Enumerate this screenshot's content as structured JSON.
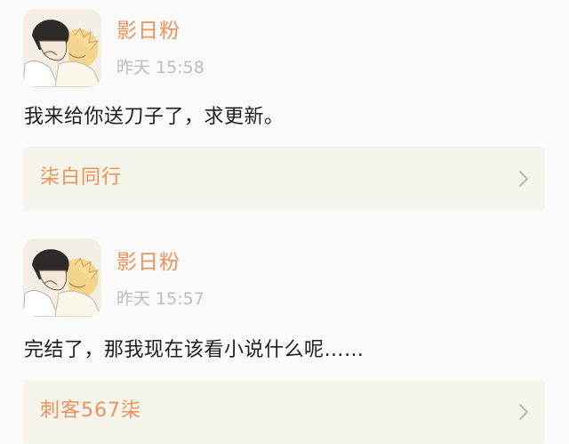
{
  "comments": [
    {
      "username": "影日粉",
      "timestamp": "昨天 15:58",
      "content": "我来给你送刀子了，求更新。",
      "reference": {
        "title": "柒白同行"
      }
    },
    {
      "username": "影日粉",
      "timestamp": "昨天 15:57",
      "content": "完结了，那我现在该看小说什么呢……",
      "reference": {
        "title": "刺客567柒"
      }
    }
  ],
  "colors": {
    "accent": "#ea9259",
    "timestamp": "#bdbdbd",
    "card_bg": "#f6f5ec",
    "page_bg": "#fbfafb"
  },
  "icons": {
    "reference_arrow": "chevron-right-icon"
  }
}
